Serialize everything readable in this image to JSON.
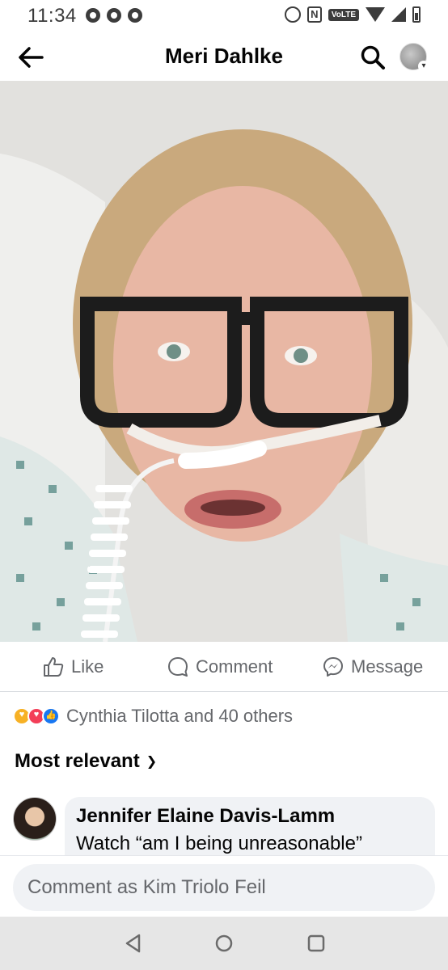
{
  "status_bar": {
    "time": "11:34",
    "volte_label": "VoLTE",
    "icons": [
      "chrome-icon",
      "chrome-icon",
      "chrome-icon",
      "alarm-icon",
      "nfc-icon",
      "volte-icon",
      "wifi-icon",
      "signal-icon",
      "battery-icon"
    ]
  },
  "header": {
    "title": "Meri Dahlke",
    "back_icon": "arrow-left-icon",
    "search_icon": "search-icon",
    "profile_icon": "avatar"
  },
  "actions": {
    "like_label": "Like",
    "comment_label": "Comment",
    "message_label": "Message"
  },
  "reactions": {
    "types": [
      "care",
      "love",
      "like"
    ],
    "summary": "Cynthia Tilotta and 40 others"
  },
  "sort": {
    "label": "Most relevant"
  },
  "comments": [
    {
      "author": "Jennifer Elaine Davis-Lamm",
      "text": "Watch “am I being unreasonable”"
    }
  ],
  "composer": {
    "placeholder": "Comment as Kim Triolo Feil"
  },
  "nav": {
    "buttons": [
      "back-nav-icon",
      "home-nav-icon",
      "recents-nav-icon"
    ]
  },
  "colors": {
    "like_blue": "#1877f2",
    "love_red": "#f33e58",
    "care_yellow": "#f7b125",
    "secondary_text": "#65676b"
  }
}
